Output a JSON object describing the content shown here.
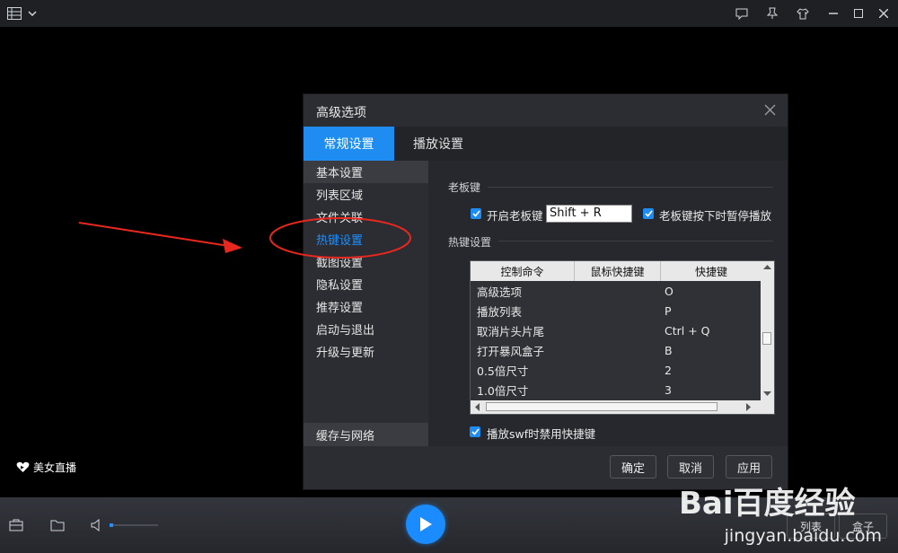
{
  "promo": {
    "label": "美女直播"
  },
  "bottombar": {
    "record_label": "列表",
    "box_label": "盒子"
  },
  "dialog": {
    "title": "高级选项",
    "tabs": [
      {
        "label": "常规设置"
      },
      {
        "label": "播放设置"
      }
    ],
    "sidebar": {
      "items": [
        {
          "label": "基本设置"
        },
        {
          "label": "列表区域"
        },
        {
          "label": "文件关联"
        },
        {
          "label": "热键设置"
        },
        {
          "label": "截图设置"
        },
        {
          "label": "隐私设置"
        },
        {
          "label": "推荐设置"
        },
        {
          "label": "启动与退出"
        },
        {
          "label": "升级与更新"
        }
      ],
      "bottom_item": "缓存与网络"
    },
    "boss_key": {
      "section_title": "老板键",
      "enable_label": "开启老板键",
      "hotkey_value": "Shift + R",
      "pause_label": "老板键按下时暂停播放"
    },
    "hotkeys": {
      "section_title": "热键设置",
      "columns": [
        "控制命令",
        "鼠标快捷键",
        "快捷键"
      ],
      "rows": [
        {
          "command": "高级选项",
          "mouse": "",
          "key": "O"
        },
        {
          "command": "播放列表",
          "mouse": "",
          "key": "P"
        },
        {
          "command": "取消片头片尾",
          "mouse": "",
          "key": "Ctrl + Q"
        },
        {
          "command": "打开暴风盒子",
          "mouse": "",
          "key": "B"
        },
        {
          "command": "0.5倍尺寸",
          "mouse": "",
          "key": "2"
        },
        {
          "command": "1.0倍尺寸",
          "mouse": "",
          "key": "3"
        }
      ],
      "disable_swf_label": "播放swf时禁用快捷键"
    },
    "buttons": {
      "ok": "确定",
      "cancel": "取消",
      "apply": "应用"
    }
  },
  "watermark": {
    "brand": "Bai百度经验",
    "url": "jingyan.baidu.com"
  },
  "colors": {
    "accent": "#1e8cf0",
    "annotation": "#e8281e"
  }
}
